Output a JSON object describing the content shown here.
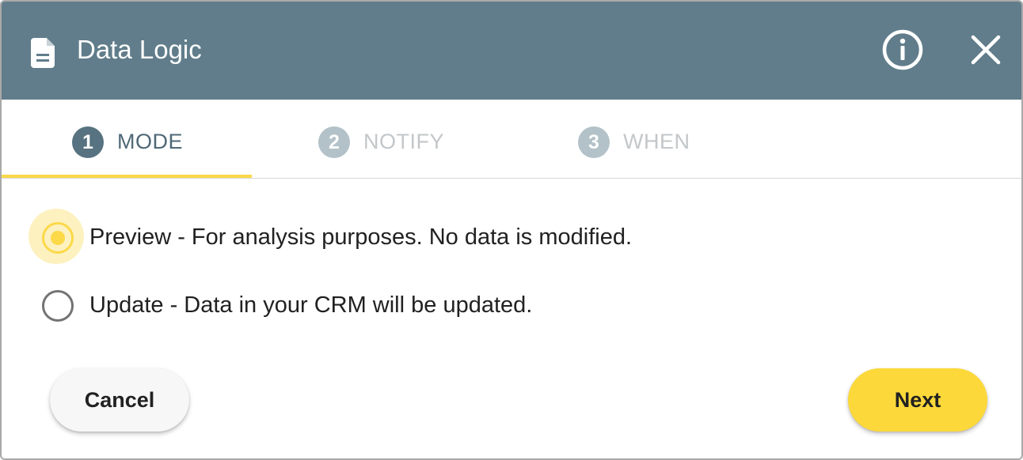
{
  "dialog": {
    "title": "Data Logic",
    "icons": {
      "title_icon": "document-icon",
      "info": "info-icon",
      "close": "close-icon"
    },
    "header_color": "#617d8b"
  },
  "steps": [
    {
      "number": "1",
      "label": "MODE",
      "active": true
    },
    {
      "number": "2",
      "label": "NOTIFY",
      "active": false
    },
    {
      "number": "3",
      "label": "WHEN",
      "active": false
    }
  ],
  "mode_options": [
    {
      "label": "Preview - For analysis purposes. No data is modified.",
      "selected": true
    },
    {
      "label": "Update - Data in your CRM will be updated.",
      "selected": false
    }
  ],
  "actions": {
    "cancel_label": "Cancel",
    "next_label": "Next"
  },
  "colors": {
    "accent": "#fbd948",
    "active_step": "#577280",
    "inactive_step": "#b3c1c8"
  }
}
